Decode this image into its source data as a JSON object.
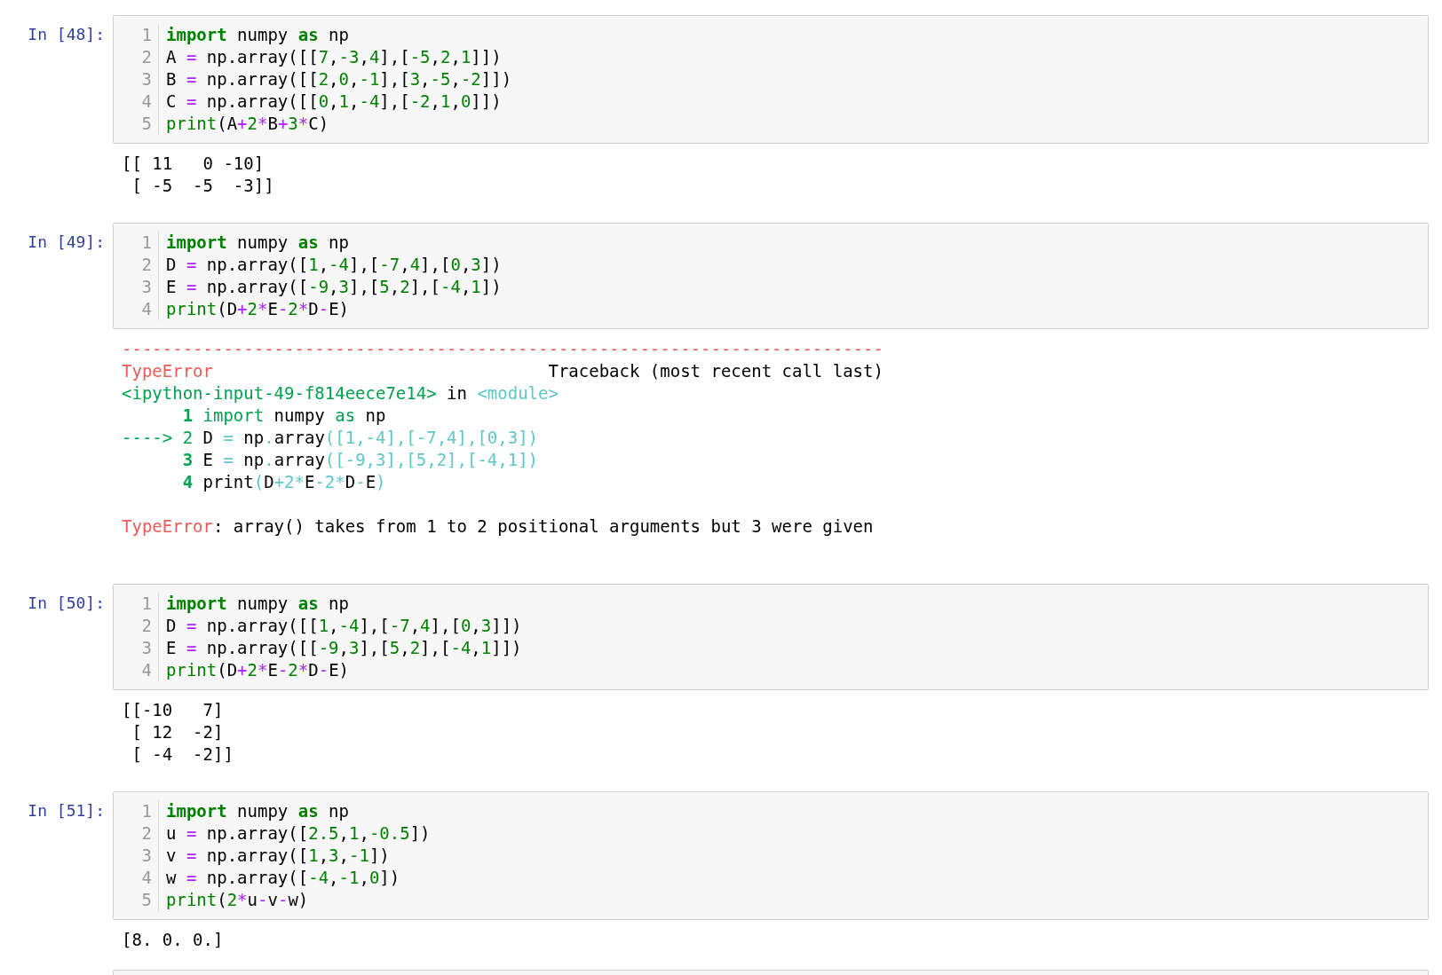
{
  "cells": [
    {
      "prompt": "In [48]:",
      "code": [
        [
          {
            "text": "import",
            "kind": "kw"
          },
          {
            "text": " numpy ",
            "kind": "n"
          },
          {
            "text": "as",
            "kind": "kw"
          },
          {
            "text": " np",
            "kind": "n"
          }
        ],
        [
          {
            "text": "A ",
            "kind": "n"
          },
          {
            "text": "=",
            "kind": "op"
          },
          {
            "text": " np.array([[",
            "kind": "n"
          },
          {
            "text": "7",
            "kind": "num"
          },
          {
            "text": ",",
            "kind": "n"
          },
          {
            "text": "-3",
            "kind": "num"
          },
          {
            "text": ",",
            "kind": "n"
          },
          {
            "text": "4",
            "kind": "num"
          },
          {
            "text": "],[",
            "kind": "n"
          },
          {
            "text": "-5",
            "kind": "num"
          },
          {
            "text": ",",
            "kind": "n"
          },
          {
            "text": "2",
            "kind": "num"
          },
          {
            "text": ",",
            "kind": "n"
          },
          {
            "text": "1",
            "kind": "num"
          },
          {
            "text": "]])",
            "kind": "n"
          }
        ],
        [
          {
            "text": "B ",
            "kind": "n"
          },
          {
            "text": "=",
            "kind": "op"
          },
          {
            "text": " np.array([[",
            "kind": "n"
          },
          {
            "text": "2",
            "kind": "num"
          },
          {
            "text": ",",
            "kind": "n"
          },
          {
            "text": "0",
            "kind": "num"
          },
          {
            "text": ",",
            "kind": "n"
          },
          {
            "text": "-1",
            "kind": "num"
          },
          {
            "text": "],[",
            "kind": "n"
          },
          {
            "text": "3",
            "kind": "num"
          },
          {
            "text": ",",
            "kind": "n"
          },
          {
            "text": "-5",
            "kind": "num"
          },
          {
            "text": ",",
            "kind": "n"
          },
          {
            "text": "-2",
            "kind": "num"
          },
          {
            "text": "]])",
            "kind": "n"
          }
        ],
        [
          {
            "text": "C ",
            "kind": "n"
          },
          {
            "text": "=",
            "kind": "op"
          },
          {
            "text": " np.array([[",
            "kind": "n"
          },
          {
            "text": "0",
            "kind": "num"
          },
          {
            "text": ",",
            "kind": "n"
          },
          {
            "text": "1",
            "kind": "num"
          },
          {
            "text": ",",
            "kind": "n"
          },
          {
            "text": "-4",
            "kind": "num"
          },
          {
            "text": "],[",
            "kind": "n"
          },
          {
            "text": "-2",
            "kind": "num"
          },
          {
            "text": ",",
            "kind": "n"
          },
          {
            "text": "1",
            "kind": "num"
          },
          {
            "text": ",",
            "kind": "n"
          },
          {
            "text": "0",
            "kind": "num"
          },
          {
            "text": "]])",
            "kind": "n"
          }
        ],
        [
          {
            "text": "print",
            "kind": "bi"
          },
          {
            "text": "(A",
            "kind": "n"
          },
          {
            "text": "+",
            "kind": "op"
          },
          {
            "text": "2",
            "kind": "num"
          },
          {
            "text": "*",
            "kind": "op"
          },
          {
            "text": "B",
            "kind": "n"
          },
          {
            "text": "+",
            "kind": "op"
          },
          {
            "text": "3",
            "kind": "num"
          },
          {
            "text": "*",
            "kind": "op"
          },
          {
            "text": "C)",
            "kind": "n"
          }
        ]
      ],
      "line_numbers": [
        "1",
        "2",
        "3",
        "4",
        "5"
      ],
      "output": {
        "kind": "stream",
        "lines": [
          "[[ 11   0 -10]",
          " [ -5  -5  -3]]"
        ]
      }
    },
    {
      "prompt": "In [49]:",
      "code": [
        [
          {
            "text": "import",
            "kind": "kw"
          },
          {
            "text": " numpy ",
            "kind": "n"
          },
          {
            "text": "as",
            "kind": "kw"
          },
          {
            "text": " np",
            "kind": "n"
          }
        ],
        [
          {
            "text": "D ",
            "kind": "n"
          },
          {
            "text": "=",
            "kind": "op"
          },
          {
            "text": " np.array([",
            "kind": "n"
          },
          {
            "text": "1",
            "kind": "num"
          },
          {
            "text": ",",
            "kind": "n"
          },
          {
            "text": "-4",
            "kind": "num"
          },
          {
            "text": "],[",
            "kind": "n"
          },
          {
            "text": "-7",
            "kind": "num"
          },
          {
            "text": ",",
            "kind": "n"
          },
          {
            "text": "4",
            "kind": "num"
          },
          {
            "text": "],[",
            "kind": "n"
          },
          {
            "text": "0",
            "kind": "num"
          },
          {
            "text": ",",
            "kind": "n"
          },
          {
            "text": "3",
            "kind": "num"
          },
          {
            "text": "])",
            "kind": "n"
          }
        ],
        [
          {
            "text": "E ",
            "kind": "n"
          },
          {
            "text": "=",
            "kind": "op"
          },
          {
            "text": " np.array([",
            "kind": "n"
          },
          {
            "text": "-9",
            "kind": "num"
          },
          {
            "text": ",",
            "kind": "n"
          },
          {
            "text": "3",
            "kind": "num"
          },
          {
            "text": "],[",
            "kind": "n"
          },
          {
            "text": "5",
            "kind": "num"
          },
          {
            "text": ",",
            "kind": "n"
          },
          {
            "text": "2",
            "kind": "num"
          },
          {
            "text": "],[",
            "kind": "n"
          },
          {
            "text": "-4",
            "kind": "num"
          },
          {
            "text": ",",
            "kind": "n"
          },
          {
            "text": "1",
            "kind": "num"
          },
          {
            "text": "])",
            "kind": "n"
          }
        ],
        [
          {
            "text": "print",
            "kind": "bi"
          },
          {
            "text": "(D",
            "kind": "n"
          },
          {
            "text": "+",
            "kind": "op"
          },
          {
            "text": "2",
            "kind": "num"
          },
          {
            "text": "*",
            "kind": "op"
          },
          {
            "text": "E",
            "kind": "n"
          },
          {
            "text": "-",
            "kind": "op"
          },
          {
            "text": "2",
            "kind": "num"
          },
          {
            "text": "*",
            "kind": "op"
          },
          {
            "text": "D",
            "kind": "n"
          },
          {
            "text": "-",
            "kind": "op"
          },
          {
            "text": "E)",
            "kind": "n"
          }
        ]
      ],
      "line_numbers": [
        "1",
        "2",
        "3",
        "4"
      ],
      "output": {
        "kind": "error",
        "traceback": [
          [
            {
              "text": "---------------------------------------------------------------------------",
              "kind": "red"
            }
          ],
          [
            {
              "text": "TypeError",
              "kind": "red"
            },
            {
              "text": "                                 Traceback (most recent call last)",
              "kind": "n"
            }
          ],
          [
            {
              "text": "<ipython-input-49-f814eece7e14>",
              "kind": "green"
            },
            {
              "text": " in ",
              "kind": "n"
            },
            {
              "text": "<module>",
              "kind": "cyan"
            }
          ],
          [
            {
              "text": "      1 ",
              "kind": "gbold"
            },
            {
              "text": "import",
              "kind": "green"
            },
            {
              "text": " numpy ",
              "kind": "n"
            },
            {
              "text": "as",
              "kind": "green"
            },
            {
              "text": " np",
              "kind": "n"
            }
          ],
          [
            {
              "text": "----> 2 ",
              "kind": "green"
            },
            {
              "text": "D ",
              "kind": "n"
            },
            {
              "text": "=",
              "kind": "cyan"
            },
            {
              "text": " np",
              "kind": "n"
            },
            {
              "text": ".",
              "kind": "cyan"
            },
            {
              "text": "array",
              "kind": "n"
            },
            {
              "text": "([1,-4],[-7,4],[0,3])",
              "kind": "cyan"
            }
          ],
          [
            {
              "text": "      3 ",
              "kind": "gbold"
            },
            {
              "text": "E ",
              "kind": "n"
            },
            {
              "text": "=",
              "kind": "cyan"
            },
            {
              "text": " np",
              "kind": "n"
            },
            {
              "text": ".",
              "kind": "cyan"
            },
            {
              "text": "array",
              "kind": "n"
            },
            {
              "text": "([-9,3],[5,2],[-4,1])",
              "kind": "cyan"
            }
          ],
          [
            {
              "text": "      4 ",
              "kind": "gbold"
            },
            {
              "text": "print",
              "kind": "n"
            },
            {
              "text": "(",
              "kind": "cyan"
            },
            {
              "text": "D",
              "kind": "n"
            },
            {
              "text": "+2*",
              "kind": "cyan"
            },
            {
              "text": "E",
              "kind": "n"
            },
            {
              "text": "-2*",
              "kind": "cyan"
            },
            {
              "text": "D",
              "kind": "n"
            },
            {
              "text": "-",
              "kind": "cyan"
            },
            {
              "text": "E",
              "kind": "n"
            },
            {
              "text": ")",
              "kind": "cyan"
            }
          ]
        ],
        "message": [
          {
            "text": "TypeError",
            "kind": "red"
          },
          {
            "text": ": array() takes from 1 to 2 positional arguments but 3 were given",
            "kind": "n"
          }
        ]
      }
    },
    {
      "prompt": "In [50]:",
      "code": [
        [
          {
            "text": "import",
            "kind": "kw"
          },
          {
            "text": " numpy ",
            "kind": "n"
          },
          {
            "text": "as",
            "kind": "kw"
          },
          {
            "text": " np",
            "kind": "n"
          }
        ],
        [
          {
            "text": "D ",
            "kind": "n"
          },
          {
            "text": "=",
            "kind": "op"
          },
          {
            "text": " np.array([[",
            "kind": "n"
          },
          {
            "text": "1",
            "kind": "num"
          },
          {
            "text": ",",
            "kind": "n"
          },
          {
            "text": "-4",
            "kind": "num"
          },
          {
            "text": "],[",
            "kind": "n"
          },
          {
            "text": "-7",
            "kind": "num"
          },
          {
            "text": ",",
            "kind": "n"
          },
          {
            "text": "4",
            "kind": "num"
          },
          {
            "text": "],[",
            "kind": "n"
          },
          {
            "text": "0",
            "kind": "num"
          },
          {
            "text": ",",
            "kind": "n"
          },
          {
            "text": "3",
            "kind": "num"
          },
          {
            "text": "]])",
            "kind": "n"
          }
        ],
        [
          {
            "text": "E ",
            "kind": "n"
          },
          {
            "text": "=",
            "kind": "op"
          },
          {
            "text": " np.array([[",
            "kind": "n"
          },
          {
            "text": "-9",
            "kind": "num"
          },
          {
            "text": ",",
            "kind": "n"
          },
          {
            "text": "3",
            "kind": "num"
          },
          {
            "text": "],[",
            "kind": "n"
          },
          {
            "text": "5",
            "kind": "num"
          },
          {
            "text": ",",
            "kind": "n"
          },
          {
            "text": "2",
            "kind": "num"
          },
          {
            "text": "],[",
            "kind": "n"
          },
          {
            "text": "-4",
            "kind": "num"
          },
          {
            "text": ",",
            "kind": "n"
          },
          {
            "text": "1",
            "kind": "num"
          },
          {
            "text": "]])",
            "kind": "n"
          }
        ],
        [
          {
            "text": "print",
            "kind": "bi"
          },
          {
            "text": "(D",
            "kind": "n"
          },
          {
            "text": "+",
            "kind": "op"
          },
          {
            "text": "2",
            "kind": "num"
          },
          {
            "text": "*",
            "kind": "op"
          },
          {
            "text": "E",
            "kind": "n"
          },
          {
            "text": "-",
            "kind": "op"
          },
          {
            "text": "2",
            "kind": "num"
          },
          {
            "text": "*",
            "kind": "op"
          },
          {
            "text": "D",
            "kind": "n"
          },
          {
            "text": "-",
            "kind": "op"
          },
          {
            "text": "E)",
            "kind": "n"
          }
        ]
      ],
      "line_numbers": [
        "1",
        "2",
        "3",
        "4"
      ],
      "output": {
        "kind": "stream",
        "lines": [
          "[[-10   7]",
          " [ 12  -2]",
          " [ -4  -2]]"
        ]
      }
    },
    {
      "prompt": "In [51]:",
      "code": [
        [
          {
            "text": "import",
            "kind": "kw"
          },
          {
            "text": " numpy ",
            "kind": "n"
          },
          {
            "text": "as",
            "kind": "kw"
          },
          {
            "text": " np",
            "kind": "n"
          }
        ],
        [
          {
            "text": "u ",
            "kind": "n"
          },
          {
            "text": "=",
            "kind": "op"
          },
          {
            "text": " np.array([",
            "kind": "n"
          },
          {
            "text": "2.5",
            "kind": "num"
          },
          {
            "text": ",",
            "kind": "n"
          },
          {
            "text": "1",
            "kind": "num"
          },
          {
            "text": ",",
            "kind": "n"
          },
          {
            "text": "-0.5",
            "kind": "num"
          },
          {
            "text": "])",
            "kind": "n"
          }
        ],
        [
          {
            "text": "v ",
            "kind": "n"
          },
          {
            "text": "=",
            "kind": "op"
          },
          {
            "text": " np.array([",
            "kind": "n"
          },
          {
            "text": "1",
            "kind": "num"
          },
          {
            "text": ",",
            "kind": "n"
          },
          {
            "text": "3",
            "kind": "num"
          },
          {
            "text": ",",
            "kind": "n"
          },
          {
            "text": "-1",
            "kind": "num"
          },
          {
            "text": "])",
            "kind": "n"
          }
        ],
        [
          {
            "text": "w ",
            "kind": "n"
          },
          {
            "text": "=",
            "kind": "op"
          },
          {
            "text": " np.array([",
            "kind": "n"
          },
          {
            "text": "-4",
            "kind": "num"
          },
          {
            "text": ",",
            "kind": "n"
          },
          {
            "text": "-1",
            "kind": "num"
          },
          {
            "text": ",",
            "kind": "n"
          },
          {
            "text": "0",
            "kind": "num"
          },
          {
            "text": "])",
            "kind": "n"
          }
        ],
        [
          {
            "text": "print",
            "kind": "bi"
          },
          {
            "text": "(",
            "kind": "n"
          },
          {
            "text": "2",
            "kind": "num"
          },
          {
            "text": "*",
            "kind": "op"
          },
          {
            "text": "u",
            "kind": "n"
          },
          {
            "text": "-",
            "kind": "op"
          },
          {
            "text": "v",
            "kind": "n"
          },
          {
            "text": "-",
            "kind": "op"
          },
          {
            "text": "w)",
            "kind": "n"
          }
        ]
      ],
      "line_numbers": [
        "1",
        "2",
        "3",
        "4",
        "5"
      ],
      "output": {
        "kind": "stream",
        "lines": [
          "[8. 0. 0.]"
        ]
      }
    }
  ]
}
